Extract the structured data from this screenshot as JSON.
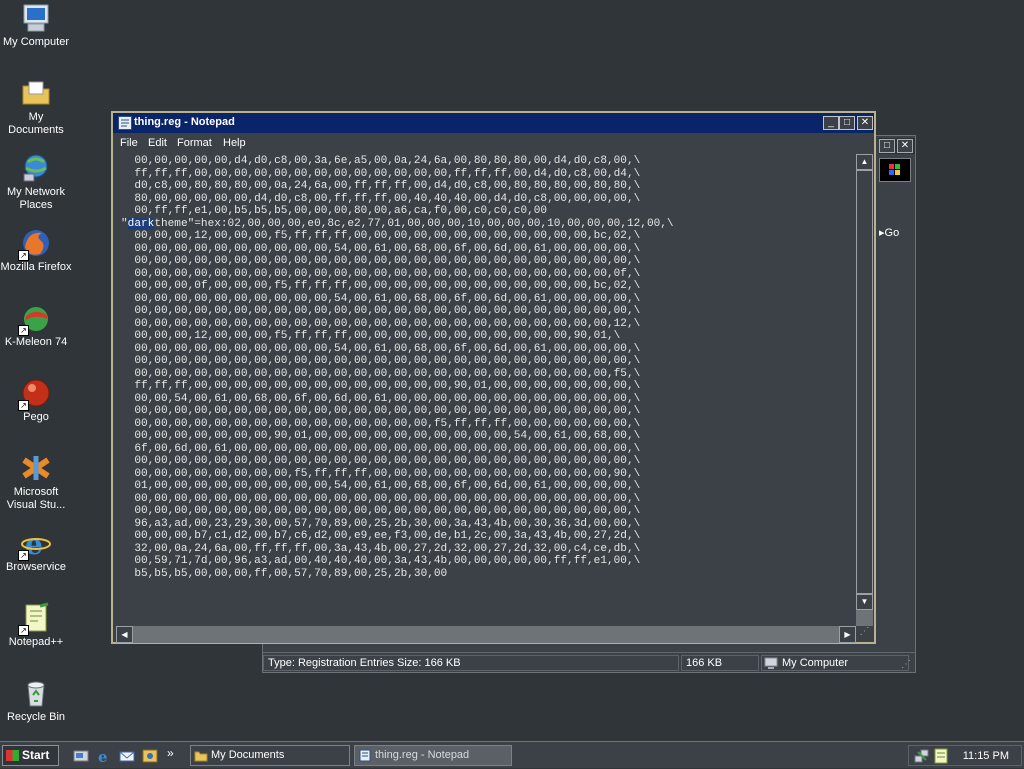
{
  "desktop": {
    "icons": [
      {
        "label": "My Computer",
        "icon": "computer-icon"
      },
      {
        "label": "My Documents",
        "icon": "folder-icon"
      },
      {
        "label": "My Network Places",
        "icon": "network-icon"
      },
      {
        "label": "Mozilla Firefox",
        "icon": "firefox-icon"
      },
      {
        "label": "K-Meleon 74",
        "icon": "kmeleon-icon"
      },
      {
        "label": "Pego",
        "icon": "pego-icon"
      },
      {
        "label": "Microsoft Visual Stu...",
        "icon": "visual-studio-icon"
      },
      {
        "label": "Browservice",
        "icon": "ie-icon"
      },
      {
        "label": "Notepad++",
        "icon": "notepadpp-icon"
      },
      {
        "label": "Recycle Bin",
        "icon": "recycle-bin-icon"
      }
    ]
  },
  "explorer": {
    "go_label": "Go",
    "status": {
      "type_text": "Type: Registration Entries Size: 166 KB",
      "size_text": "166 KB",
      "zone_text": "My Computer"
    }
  },
  "notepad": {
    "title": "thing.reg - Notepad",
    "menu": [
      "File",
      "Edit",
      "Format",
      "Help"
    ],
    "content_before": "  00,00,00,00,00,d4,d0,c8,00,3a,6e,a5,00,0a,24,6a,00,80,80,80,00,d4,d0,c8,00,\\\n  ff,ff,ff,00,00,00,00,00,00,00,00,00,00,00,00,00,ff,ff,ff,00,d4,d0,c8,00,d4,\\\n  d0,c8,00,80,80,80,00,0a,24,6a,00,ff,ff,ff,00,d4,d0,c8,00,80,80,80,00,80,80,\\\n  80,00,00,00,00,00,d4,d0,c8,00,ff,ff,ff,00,40,40,40,00,d4,d0,c8,00,00,00,00,\\\n  00,ff,ff,e1,00,b5,b5,b5,00,00,00,80,00,a6,ca,f0,00,c0,c0,c0,00\n\"",
    "content_highlight": "dark",
    "content_after": "theme\"=hex:02,00,00,00,e0,8c,e2,77,01,00,00,00,10,00,00,00,10,00,00,00,12,00,\\\n  00,00,00,12,00,00,00,f5,ff,ff,ff,00,00,00,00,00,00,00,00,00,00,00,00,bc,02,\\\n  00,00,00,00,00,00,00,00,00,00,54,00,61,00,68,00,6f,00,6d,00,61,00,00,00,00,\\\n  00,00,00,00,00,00,00,00,00,00,00,00,00,00,00,00,00,00,00,00,00,00,00,00,00,\\\n  00,00,00,00,00,00,00,00,00,00,00,00,00,00,00,00,00,00,00,00,00,00,00,00,0f,\\\n  00,00,00,0f,00,00,00,f5,ff,ff,ff,00,00,00,00,00,00,00,00,00,00,00,00,bc,02,\\\n  00,00,00,00,00,00,00,00,00,00,54,00,61,00,68,00,6f,00,6d,00,61,00,00,00,00,\\\n  00,00,00,00,00,00,00,00,00,00,00,00,00,00,00,00,00,00,00,00,00,00,00,00,00,\\\n  00,00,00,00,00,00,00,00,00,00,00,00,00,00,00,00,00,00,00,00,00,00,00,00,12,\\\n  00,00,00,12,00,00,00,f5,ff,ff,ff,00,00,00,00,00,00,00,00,00,00,00,90,01,\\\n  00,00,00,00,00,00,00,00,00,00,54,00,61,00,68,00,6f,00,6d,00,61,00,00,00,00,\\\n  00,00,00,00,00,00,00,00,00,00,00,00,00,00,00,00,00,00,00,00,00,00,00,00,00,\\\n  00,00,00,00,00,00,00,00,00,00,00,00,00,00,00,00,00,00,00,00,00,00,00,00,f5,\\\n  ff,ff,ff,00,00,00,00,00,00,00,00,00,00,00,00,00,90,01,00,00,00,00,00,00,00,\\\n  00,00,54,00,61,00,68,00,6f,00,6d,00,61,00,00,00,00,00,00,00,00,00,00,00,00,\\\n  00,00,00,00,00,00,00,00,00,00,00,00,00,00,00,00,00,00,00,00,00,00,00,00,00,\\\n  00,00,00,00,00,00,00,00,00,00,00,00,00,00,00,f5,ff,ff,ff,00,00,00,00,00,00,\\\n  00,00,00,00,00,00,00,90,01,00,00,00,00,00,00,00,00,00,00,54,00,61,00,68,00,\\\n  6f,00,6d,00,61,00,00,00,00,00,00,00,00,00,00,00,00,00,00,00,00,00,00,00,00,\\\n  00,00,00,00,00,00,00,00,00,00,00,00,00,00,00,00,00,00,00,00,00,00,00,00,00,\\\n  00,00,00,00,00,00,00,00,f5,ff,ff,ff,00,00,00,00,00,00,00,00,00,00,00,00,90,\\\n  01,00,00,00,00,00,00,00,00,00,54,00,61,00,68,00,6f,00,6d,00,61,00,00,00,00,\\\n  00,00,00,00,00,00,00,00,00,00,00,00,00,00,00,00,00,00,00,00,00,00,00,00,00,\\\n  00,00,00,00,00,00,00,00,00,00,00,00,00,00,00,00,00,00,00,00,00,00,00,00,00,\\\n  96,a3,ad,00,23,29,30,00,57,70,89,00,25,2b,30,00,3a,43,4b,00,30,36,3d,00,00,\\\n  00,00,00,b7,c1,d2,00,b7,c6,d2,00,e9,ee,f3,00,de,b1,2c,00,3a,43,4b,00,27,2d,\\\n  32,00,0a,24,6a,00,ff,ff,ff,00,3a,43,4b,00,27,2d,32,00,27,2d,32,00,c4,ce,db,\\\n  00,59,71,7d,00,96,a3,ad,00,40,40,40,00,3a,43,4b,00,00,00,00,00,ff,ff,e1,00,\\\n  b5,b5,b5,00,00,00,ff,00,57,70,89,00,25,2b,30,00"
  },
  "taskbar": {
    "start_label": "Start",
    "quicklaunch": [
      "show-desktop-icon",
      "ie-icon",
      "outlook-icon",
      "media-icon"
    ],
    "overflow": "»",
    "tasks": [
      {
        "label": "My Documents",
        "active": false
      },
      {
        "label": "thing.reg - Notepad",
        "active": true
      }
    ],
    "clock": "11:15 PM"
  },
  "colors": {
    "desktop": "#2f3539",
    "title_active": "#0a246a",
    "window_face": "#3b4146",
    "selection": "#1c3e7a"
  }
}
